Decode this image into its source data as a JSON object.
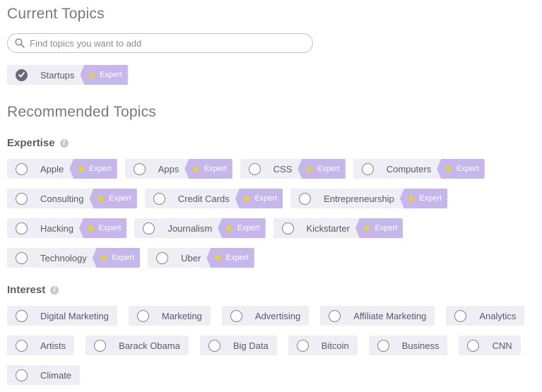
{
  "current": {
    "title": "Current Topics",
    "search_placeholder": "Find topics you want to add",
    "topics": [
      {
        "label": "Startups",
        "badge": "Expert",
        "checked": true
      }
    ]
  },
  "recommended": {
    "title": "Recommended Topics",
    "expertise": {
      "title": "Expertise",
      "rows": [
        [
          {
            "label": "Apple",
            "badge": "Expert"
          },
          {
            "label": "Apps",
            "badge": "Expert"
          },
          {
            "label": "CSS",
            "badge": "Expert"
          },
          {
            "label": "Computers",
            "badge": "Expert"
          }
        ],
        [
          {
            "label": "Consulting",
            "badge": "Expert"
          },
          {
            "label": "Credit Cards",
            "badge": "Expert"
          },
          {
            "label": "Entrepreneurship",
            "badge": "Expert"
          }
        ],
        [
          {
            "label": "Hacking",
            "badge": "Expert"
          },
          {
            "label": "Journalism",
            "badge": "Expert"
          },
          {
            "label": "Kickstarter",
            "badge": "Expert"
          }
        ],
        [
          {
            "label": "Technology",
            "badge": "Expert"
          },
          {
            "label": "Uber",
            "badge": "Expert"
          }
        ]
      ]
    },
    "interest": {
      "title": "Interest",
      "rows": [
        [
          {
            "label": "Digital Marketing"
          },
          {
            "label": "Marketing"
          },
          {
            "label": "Advertising"
          },
          {
            "label": "Affiliate Marketing"
          },
          {
            "label": "Analytics"
          }
        ],
        [
          {
            "label": "Artists"
          },
          {
            "label": "Barack Obama"
          },
          {
            "label": "Big Data"
          },
          {
            "label": "Bitcoin"
          },
          {
            "label": "Business"
          },
          {
            "label": "CNN"
          }
        ],
        [
          {
            "label": "Climate"
          }
        ]
      ]
    }
  },
  "colors": {
    "badge": "#c5b6ec",
    "chip": "#efeef5",
    "star": "#f5d800"
  }
}
